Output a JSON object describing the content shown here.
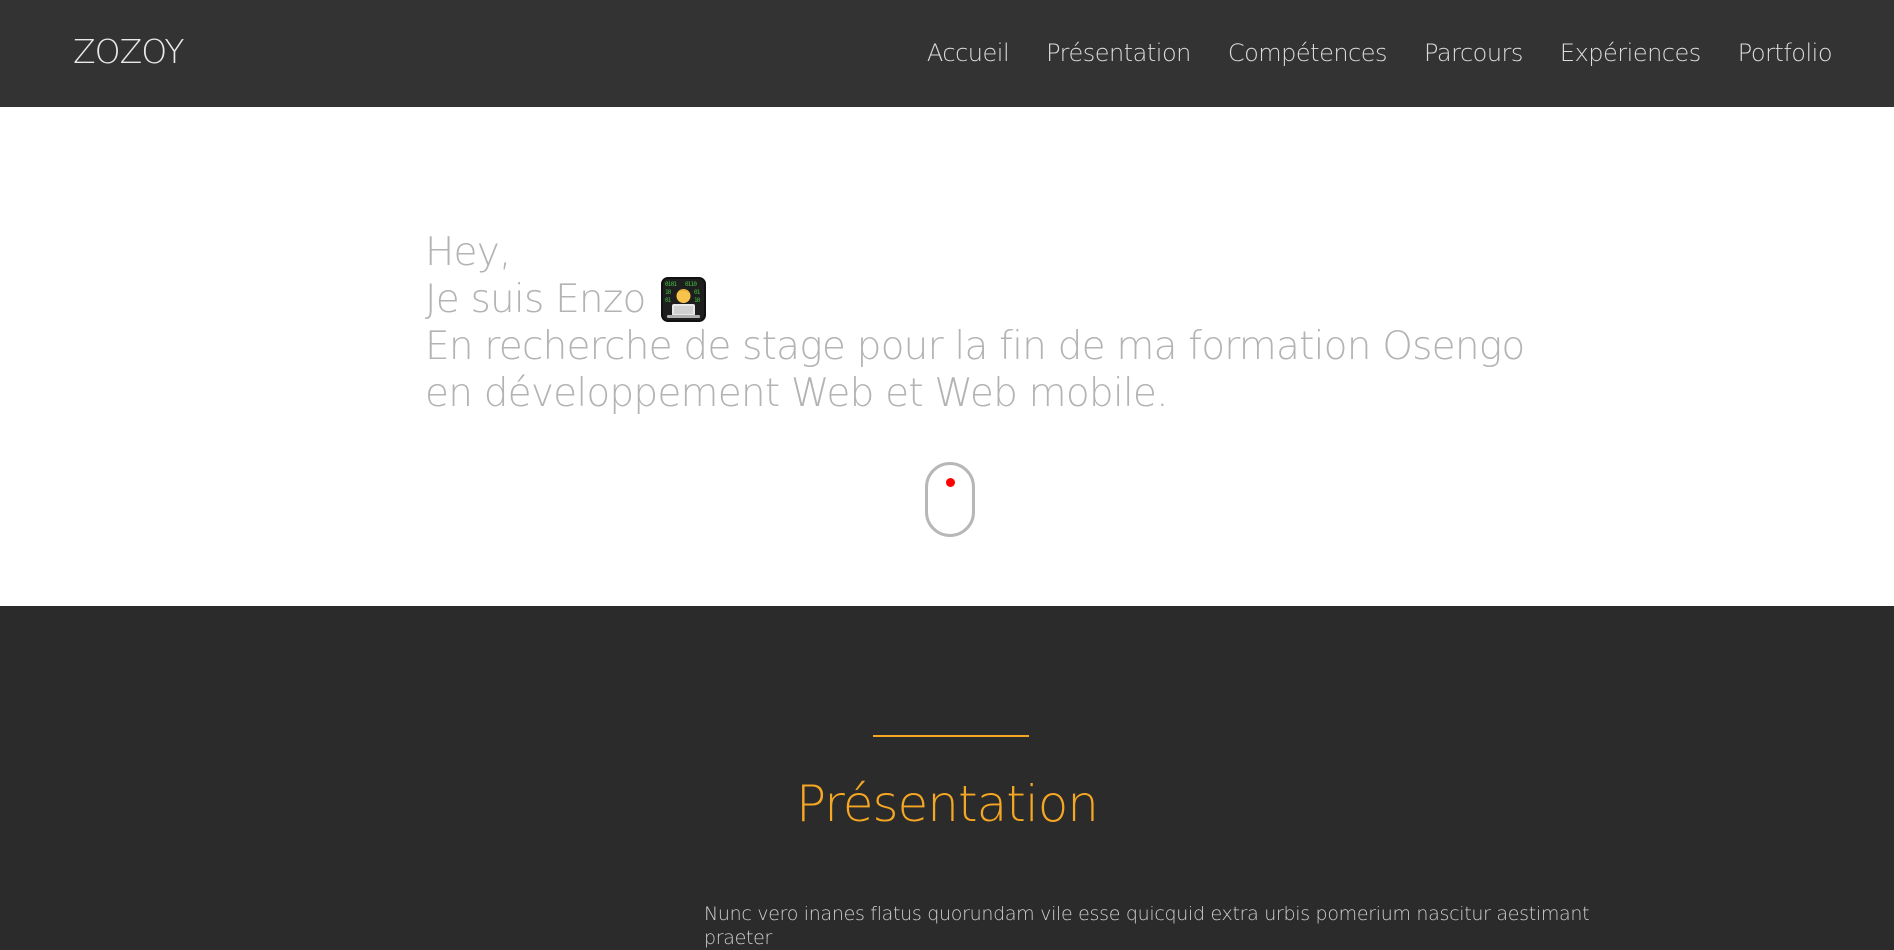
{
  "navbar": {
    "brand": "ZOZOY",
    "links": [
      "Accueil",
      "Présentation",
      "Compétences",
      "Parcours",
      "Expériences",
      "Portfolio"
    ]
  },
  "hero": {
    "greeting": "Hey,",
    "intro": "Je suis Enzo",
    "line3": "En recherche de stage pour la fin de ma formation Osengo",
    "line4": "en développement Web et Web mobile.",
    "emoji_icon": "technologist-emoji-icon"
  },
  "presentation": {
    "title": "Présentation",
    "body": "Nunc vero inanes flatus quorundam vile esse quicquid extra urbis pomerium nascitur aestimant praeter"
  },
  "colors": {
    "accent": "#f5a623",
    "dark_bg": "#2b2b2b",
    "navbar_bg": "#333333",
    "scroll_dot": "#ff0000"
  }
}
